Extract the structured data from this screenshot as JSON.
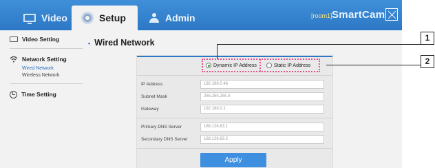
{
  "header": {
    "tabs": [
      {
        "label": "Video",
        "icon": "monitor-icon",
        "active": false
      },
      {
        "label": "Setup",
        "icon": "gear-icon",
        "active": true
      },
      {
        "label": "Admin",
        "icon": "person-icon",
        "active": false
      }
    ],
    "device_label": "[room1]",
    "brand": "SmartCam"
  },
  "sidebar": {
    "items": [
      {
        "label": "Video Setting",
        "icon": "monitor-icon"
      },
      {
        "label": "Network Setting",
        "icon": "wifi-icon",
        "sub": [
          "Wired Network",
          "Wireless Network"
        ]
      },
      {
        "label": "Time Setting",
        "icon": "clock-icon"
      }
    ]
  },
  "main": {
    "title": "Wired Network",
    "ip_mode": {
      "options": [
        "Dynamic IP Address",
        "Static IP Address"
      ],
      "selected": "Dynamic IP Address"
    },
    "fields": [
      {
        "label": "IP Address",
        "value": "192.168.0.46"
      },
      {
        "label": "Subnet Mask",
        "value": "255.255.255.0"
      },
      {
        "label": "Gateway",
        "value": "192.168.0.1"
      },
      {
        "label": "Primary DNS Server",
        "value": "168.126.63.1"
      },
      {
        "label": "Secondary DNS Server",
        "value": "168.126.63.2"
      }
    ],
    "apply_label": "Apply"
  },
  "callouts": [
    "1",
    "2"
  ],
  "colors": {
    "header": "#2d78c6",
    "accent": "#3e8fe0",
    "highlight_border": "#e0528c",
    "device_label": "#ffe27a"
  }
}
